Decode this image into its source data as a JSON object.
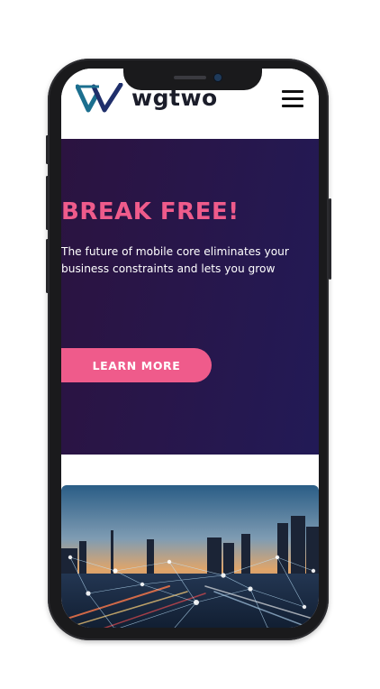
{
  "header": {
    "logo_text": "wgtwo",
    "menu_icon": "hamburger-menu-icon"
  },
  "hero": {
    "title": "BREAK FREE!",
    "subtitle": "The future of mobile core eliminates your business constraints and lets you grow",
    "cta_label": "LEARN MORE"
  },
  "colors": {
    "accent": "#ef5b8b",
    "hero_bg": "#28164a",
    "logo_teal": "#1c6f8f",
    "logo_blue": "#1f2f6b"
  },
  "image": {
    "subject": "city-network-image"
  }
}
